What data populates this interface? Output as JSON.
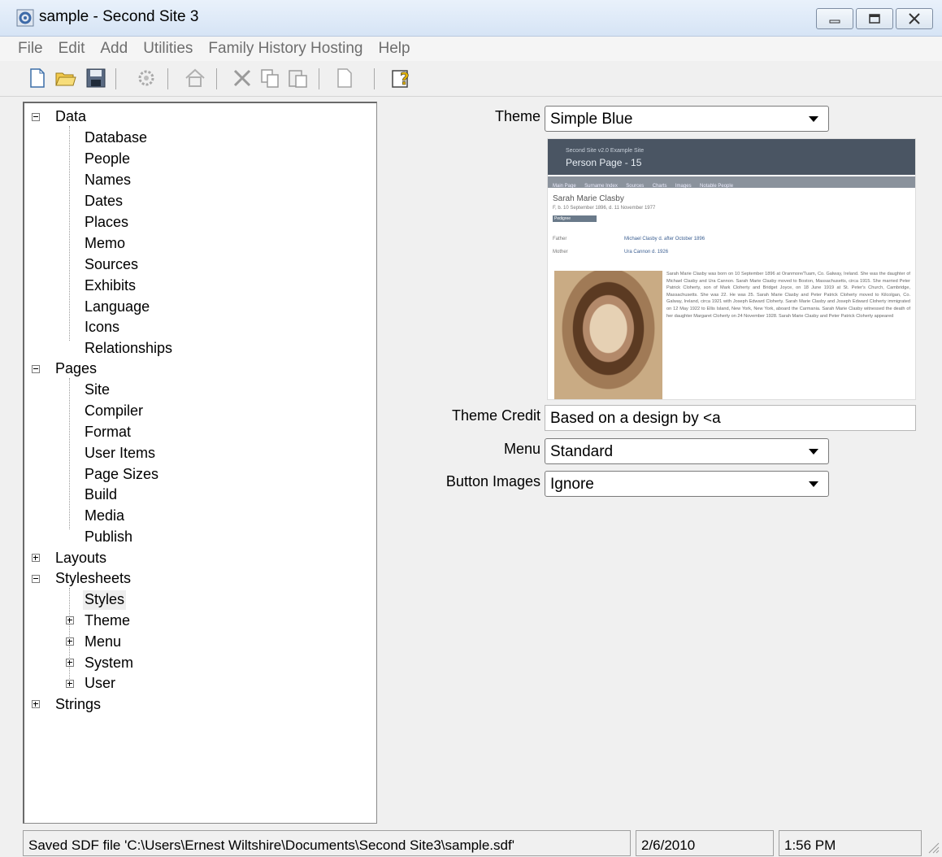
{
  "window": {
    "title": "sample - Second Site 3"
  },
  "menu": [
    "File",
    "Edit",
    "Add",
    "Utilities",
    "Family History Hosting",
    "Help"
  ],
  "toolbar": {
    "icons": [
      "new-file-icon",
      "open-folder-icon",
      "save-icon",
      "settings-gear-icon",
      "home-icon",
      "cut-icon",
      "copy-icon",
      "paste-icon",
      "blank-page-icon",
      "help-icon"
    ]
  },
  "tree": {
    "data": {
      "label": "Data",
      "children": [
        "Database",
        "People",
        "Names",
        "Dates",
        "Places",
        "Memo",
        "Sources",
        "Exhibits",
        "Language",
        "Icons",
        "Relationships"
      ]
    },
    "pages": {
      "label": "Pages",
      "children": [
        "Site",
        "Compiler",
        "Format",
        "User Items",
        "Page Sizes",
        "Build",
        "Media",
        "Publish"
      ]
    },
    "layouts": {
      "label": "Layouts"
    },
    "stylesheets": {
      "label": "Stylesheets",
      "children": [
        "Styles",
        "Theme",
        "Menu",
        "System",
        "User"
      ]
    },
    "strings": {
      "label": "Strings"
    },
    "selected": "Styles"
  },
  "form": {
    "theme_label": "Theme",
    "theme_value": "Simple Blue",
    "theme_credit_label": "Theme Credit",
    "theme_credit_value": "Based on a design by <a",
    "menu_label": "Menu",
    "menu_value": "Standard",
    "button_images_label": "Button Images",
    "button_images_value": "Ignore"
  },
  "preview": {
    "site_name": "Second Site v2.0 Example Site",
    "page_title": "Person Page - 15",
    "nav": [
      "Main Page",
      "Surname Index",
      "Sources",
      "Charts",
      "Images",
      "Notable People"
    ],
    "person_name": "Sarah Marie Clasby",
    "person_dates": "F, b. 10 September 1896, d. 11 November 1977",
    "badge": "Pedigree",
    "father_label": "Father",
    "father_value": "Michael Clasby d. after October 1896",
    "mother_label": "Mother",
    "mother_value": "Ura Cannon d. 1926",
    "bio": "Sarah Marie Clasby was born on 10 September 1896 at Oranmore/Tuam, Co. Galway, Ireland. She was the daughter of Michael Clasby and Ura Cannon. Sarah Marie Clasby moved to Boston, Massachusetts, circa 1915. She married Peter Patrick Cloherty, son of Mark Cloherty and Bridget Joyce, on 18 June 1919 at St. Peter's Church, Cambridge, Massachusetts. She was 22. He was 25. Sarah Marie Clasby and Peter Patrick Cloherty moved to Kilcolgan, Co. Galway, Ireland, circa 1921 with Joseph Edward Cloherty. Sarah Marie Clasby and Joseph Edward Cloherty immigrated on 12 May 1922 to Ellis Island, New York, New York, aboard the Carmania. Sarah Marie Clasby witnessed the death of her daughter Margaret Cloherty on 24 November 1928. Sarah Marie Clasby and Peter Patrick Cloherty appeared"
  },
  "status": {
    "message": "Saved SDF file 'C:\\Users\\Ernest Wiltshire\\Documents\\Second Site3\\sample.sdf'",
    "date": "2/6/2010",
    "time": "1:56 PM"
  }
}
